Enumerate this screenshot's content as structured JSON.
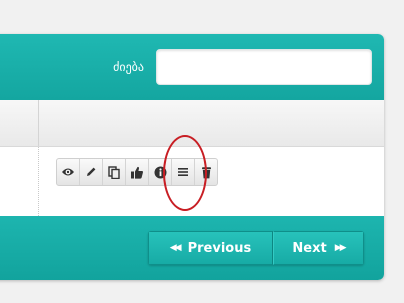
{
  "header": {
    "search_label": "ძიება",
    "search_value": "",
    "search_placeholder": ""
  },
  "toolbar": {
    "buttons": [
      {
        "name": "view",
        "icon": "eye-icon"
      },
      {
        "name": "edit",
        "icon": "pencil-icon"
      },
      {
        "name": "copy",
        "icon": "copy-icon"
      },
      {
        "name": "like",
        "icon": "thumbs-up-icon"
      },
      {
        "name": "info",
        "icon": "info-icon"
      },
      {
        "name": "menu",
        "icon": "list-icon"
      },
      {
        "name": "delete",
        "icon": "trash-icon"
      }
    ]
  },
  "pagination": {
    "previous_label": "Previous",
    "next_label": "Next"
  },
  "colors": {
    "accent": "#17aba5",
    "highlight": "#c81e24"
  }
}
